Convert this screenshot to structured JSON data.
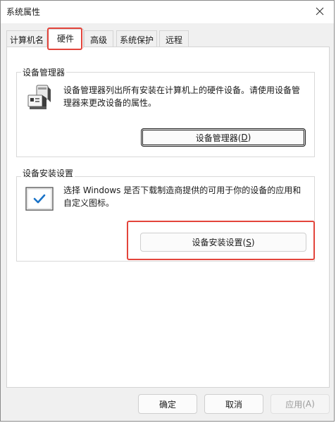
{
  "window": {
    "title": "系统属性"
  },
  "tabs": [
    {
      "label": "计算机名",
      "active": false
    },
    {
      "label": "硬件",
      "active": true
    },
    {
      "label": "高级",
      "active": false
    },
    {
      "label": "系统保护",
      "active": false
    },
    {
      "label": "远程",
      "active": false
    }
  ],
  "device_manager": {
    "group_title": "设备管理器",
    "description_line1": "设备管理器列出所有安装在计算机上的硬件设备。请使用设备管",
    "description_line2": "理器来更改设备的属性。",
    "button_text": "设备管理器(",
    "button_key": "D",
    "button_end": ")",
    "icon": "device-manager-icon"
  },
  "device_install": {
    "group_title": "设备安装设置",
    "description_line1": "选择 Windows 是否下载制造商提供的可用于你的设备的应用和",
    "description_line2": "自定义图标。",
    "button_text": "设备安装设置(",
    "button_key": "S",
    "button_end": ")",
    "icon": "checkbox-window-icon"
  },
  "footer": {
    "ok": "确定",
    "cancel": "取消",
    "apply_text": "应用(",
    "apply_key": "A",
    "apply_end": ")"
  },
  "colors": {
    "highlight": "#e3443b",
    "check": "#1a73c8"
  }
}
